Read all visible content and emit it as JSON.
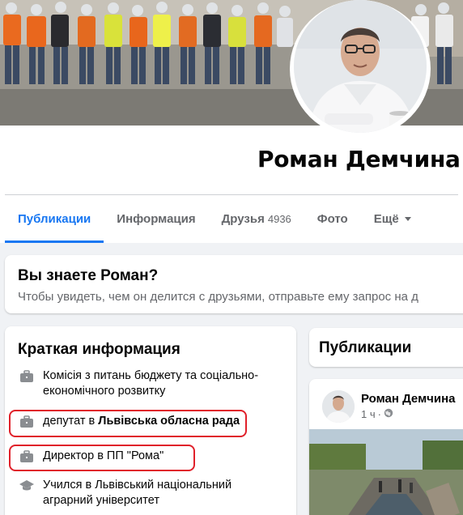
{
  "profile": {
    "name": "Роман Демчина"
  },
  "tabs": [
    {
      "label": "Публикации"
    },
    {
      "label": "Информация"
    },
    {
      "label": "Друзья",
      "count": "4936"
    },
    {
      "label": "Фото"
    },
    {
      "label": "Ещё"
    }
  ],
  "know": {
    "title": "Вы знаете Роман?",
    "subtitle": "Чтобы увидеть, чем он делится с друзьями, отправьте ему запрос на д"
  },
  "intro": {
    "title": "Краткая информация",
    "items": [
      {
        "icon": "briefcase-icon",
        "text": "Комісія з питань бюджету та соціально-",
        "text2": "економічного розвитку"
      },
      {
        "icon": "briefcase-icon",
        "prefix": "депутат в ",
        "bold": "Львівська обласна рада"
      },
      {
        "icon": "briefcase-icon",
        "text": "Директор в ПП \"Рома\""
      },
      {
        "icon": "graduation-cap-icon",
        "text": "Учился в Львівський національний",
        "text2": "аграрний університет"
      }
    ]
  },
  "posts": {
    "title": "Публикации",
    "author": "Роман Демчина",
    "time": "1 ч",
    "audience_icon": "globe-icon"
  },
  "colors": {
    "accent": "#1877f2",
    "highlight": "#e0202a",
    "muted": "#65676b"
  }
}
